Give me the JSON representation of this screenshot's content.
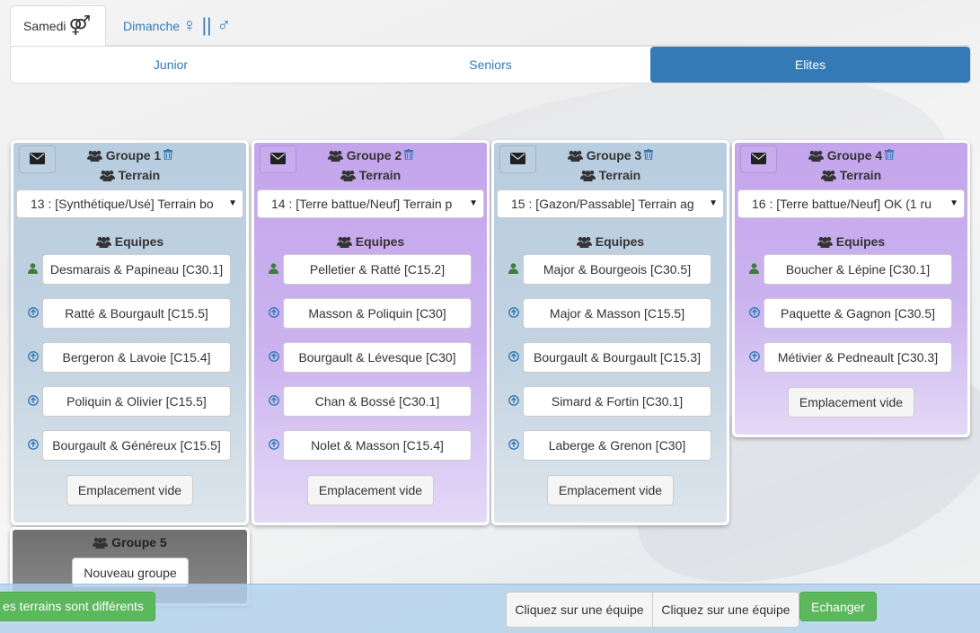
{
  "day_tabs": [
    {
      "label": "Samedi",
      "symbol": "⚤"
    },
    {
      "label": "Dimanche",
      "symbol": "♀ || ♂"
    }
  ],
  "categories": [
    "Junior",
    "Seniors",
    "Elites"
  ],
  "active_category": "Elites",
  "icons": {
    "mail": "envelope-icon",
    "group": "users-icon",
    "delete": "trash-icon",
    "captain": "user-icon",
    "player": "arrow-circle-up-icon",
    "caret": "caret-down-icon"
  },
  "colors": {
    "primary": "#337ab7",
    "success": "#5cb85c",
    "group_blue": "#b7cde0",
    "group_purple": "#c4a5ec",
    "group_new": "#6f6f6f"
  },
  "labels": {
    "terrain": "Terrain",
    "equipes": "Equipes",
    "empty_slot": "Emplacement vide",
    "caret": "▼"
  },
  "groups": [
    {
      "title": "Groupe 1",
      "terrain": "13 : [Synthétique/Usé] Terrain bo",
      "teams": [
        "Desmarais & Papineau [C30.1]",
        "Ratté & Bourgault [C15.5]",
        "Bergeron & Lavoie [C15.4]",
        "Poliquin & Olivier [C15.5]",
        "Bourgault & Généreux [C15.5]"
      ]
    },
    {
      "title": "Groupe 2",
      "terrain": "14 : [Terre battue/Neuf] Terrain p",
      "teams": [
        "Pelletier & Ratté [C15.2]",
        "Masson & Poliquin [C30]",
        "Bourgault & Lévesque [C30]",
        "Chan & Bossé [C30.1]",
        "Nolet & Masson [C15.4]"
      ]
    },
    {
      "title": "Groupe 3",
      "terrain": "15 : [Gazon/Passable] Terrain ag",
      "teams": [
        "Major & Bourgeois [C30.5]",
        "Major & Masson [C15.5]",
        "Bourgault & Bourgault [C15.3]",
        "Simard & Fortin [C30.1]",
        "Laberge & Grenon [C30]"
      ]
    },
    {
      "title": "Groupe 4",
      "terrain": "16 : [Terre battue/Neuf] OK (1 ru",
      "teams": [
        "Boucher & Lépine [C30.1]",
        "Paquette & Gagnon [C30.5]",
        "Métivier & Pedneault [C30.3]"
      ]
    }
  ],
  "new_group": {
    "title": "Groupe 5",
    "button": "Nouveau groupe"
  },
  "bottom": {
    "warning": "es terrains sont différents",
    "pick_a": "Cliquez sur une équipe",
    "pick_b": "Cliquez sur une équipe",
    "swap": "Echanger"
  }
}
